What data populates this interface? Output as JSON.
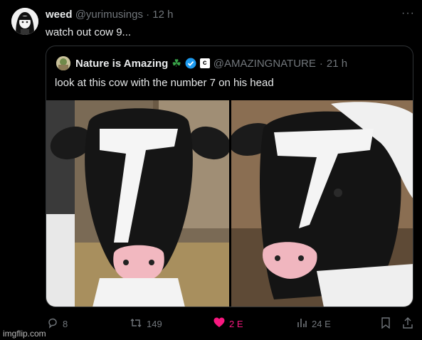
{
  "tweet": {
    "display_name": "weed",
    "handle": "@yurimusings",
    "separator": "·",
    "time": "12 h",
    "text": "watch out cow 9...",
    "more_label": "···"
  },
  "quote": {
    "display_name": "Nature is Amazing",
    "handle": "@AMAZINGNATURE",
    "separator": "·",
    "time": "21 h",
    "c_badge": "c",
    "text": "look at this cow with the number 7 on his head"
  },
  "actions": {
    "replies": "8",
    "reposts": "149",
    "likes": "2 E",
    "views": "24 E"
  },
  "colors": {
    "like_active": "#f91880",
    "verified": "#1d9bf0",
    "muted": "#71767b"
  },
  "watermark": "imgflip.com"
}
